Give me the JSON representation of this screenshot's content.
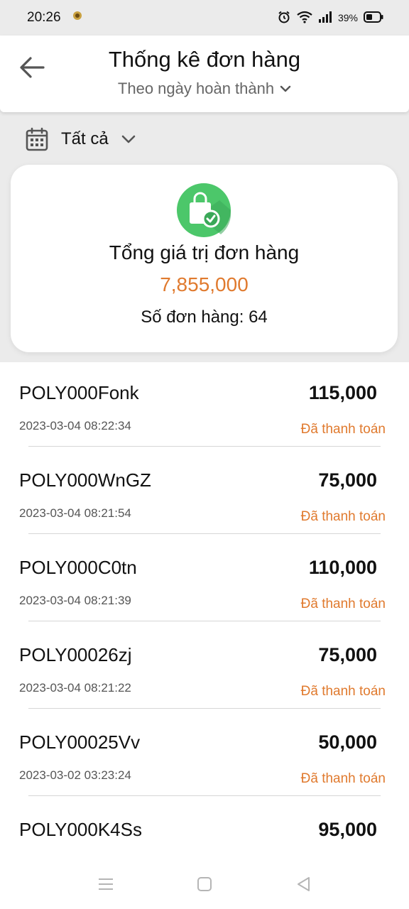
{
  "status_bar": {
    "time": "20:26",
    "battery": "39%",
    "icons": [
      "alarm-icon",
      "wifi-icon",
      "signal-icon",
      "battery-icon"
    ]
  },
  "header": {
    "title": "Thống kê đơn hàng",
    "subtitle": "Theo ngày hoàn thành"
  },
  "filter": {
    "label": "Tất cả"
  },
  "summary": {
    "title": "Tổng giá trị đơn hàng",
    "value": "7,855,000",
    "count_label": "Số đơn hàng: 64"
  },
  "orders": [
    {
      "code": "POLY000Fonk",
      "amount": "115,000",
      "date": "2023-03-04 08:22:34",
      "status": "Đã thanh toán"
    },
    {
      "code": "POLY000WnGZ",
      "amount": "75,000",
      "date": "2023-03-04 08:21:54",
      "status": "Đã thanh toán"
    },
    {
      "code": "POLY000C0tn",
      "amount": "110,000",
      "date": "2023-03-04 08:21:39",
      "status": "Đã thanh toán"
    },
    {
      "code": "POLY00026zj",
      "amount": "75,000",
      "date": "2023-03-04 08:21:22",
      "status": "Đã thanh toán"
    },
    {
      "code": "POLY00025Vv",
      "amount": "50,000",
      "date": "2023-03-02 03:23:24",
      "status": "Đã thanh toán"
    },
    {
      "code": "POLY000K4Ss",
      "amount": "95,000",
      "date": "",
      "status": ""
    }
  ],
  "colors": {
    "accent": "#e07a2e",
    "icon_green": "#4cc76a",
    "background": "#ebebeb"
  }
}
